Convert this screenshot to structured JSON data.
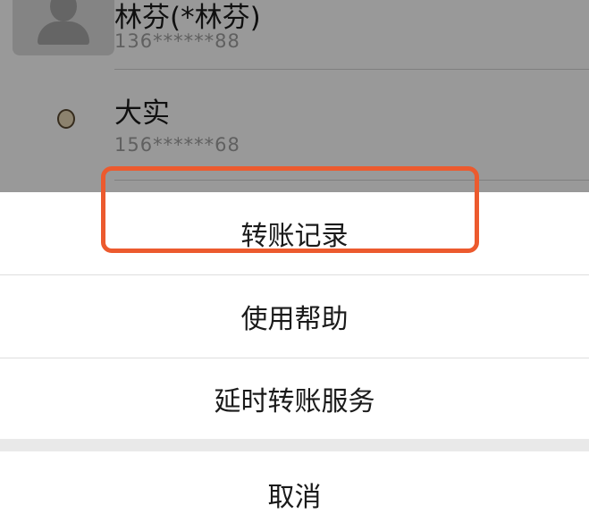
{
  "contacts": [
    {
      "name": "林芬(*林芬)",
      "phone": "136******88",
      "avatar_icon": "default-user-avatar"
    },
    {
      "name": "大实",
      "phone": "156******68",
      "avatar_icon": "emoji-avatar"
    }
  ],
  "action_sheet": {
    "items": [
      {
        "label": "转账记录"
      },
      {
        "label": "使用帮助"
      },
      {
        "label": "延时转账服务",
        "highlighted": true
      }
    ],
    "cancel_label": "取消"
  },
  "colors": {
    "highlight": "#ec5a2e",
    "overlay": "rgba(0,0,0,0.40)",
    "text": "#1a1a1a",
    "secondary_text": "#a0a0a0"
  }
}
